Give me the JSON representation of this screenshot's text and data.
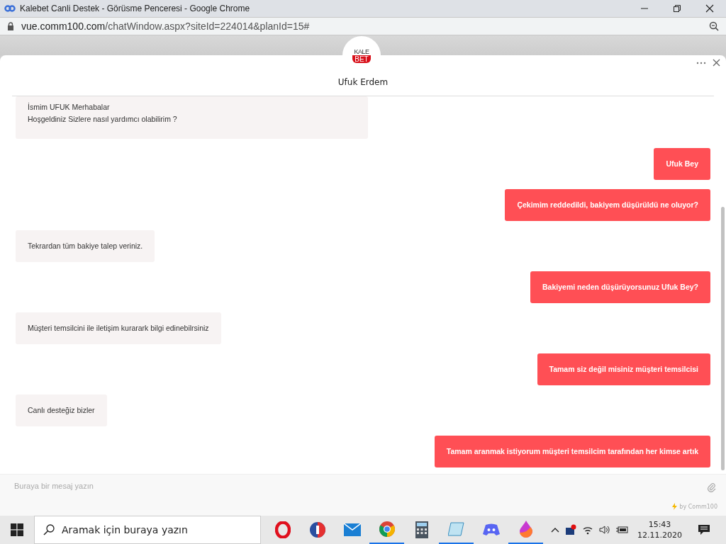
{
  "window": {
    "title": "Kalebet Canli Destek - Görüsme Penceresi - Google Chrome"
  },
  "address_bar": {
    "host": "vue.comm100.com",
    "path": "/chatWindow.aspx?siteId=224014&planId=15#"
  },
  "chat": {
    "logo_top": "KALE",
    "logo_bottom": "BET",
    "agent_name": "Ufuk Erdem",
    "messages": [
      {
        "kind": "agent",
        "lines": [
          "İsmim UFUK Merhabalar",
          "Hoşgeldiniz Sizlere nasıl yardımcı olabilirim ?"
        ]
      },
      {
        "kind": "visitor",
        "lines": [
          "Ufuk Bey"
        ]
      },
      {
        "kind": "visitor",
        "lines": [
          "Çekimim reddedildi, bakiyem düşürüldü ne oluyor?"
        ]
      },
      {
        "kind": "agent",
        "lines": [
          "Tekrardan tüm bakiye talep veriniz."
        ]
      },
      {
        "kind": "visitor",
        "lines": [
          "Bakiyemi neden düşürüyorsunuz Ufuk Bey?"
        ]
      },
      {
        "kind": "agent",
        "lines": [
          "Müşteri temsilcini ile iletişim kurarark bilgi edinebilrsiniz"
        ]
      },
      {
        "kind": "visitor",
        "lines": [
          "Tamam siz değil misiniz müşteri temsilcisi"
        ]
      },
      {
        "kind": "agent",
        "lines": [
          "Canlı desteğiz bizler"
        ]
      },
      {
        "kind": "visitor",
        "lines": [
          "Tamam aranmak istiyorum müşteri temsilcim tarafından her kimse artık"
        ]
      }
    ],
    "input": {
      "placeholder": "Buraya bir mesaj yazın"
    },
    "powered_by": "by Comm100"
  },
  "taskbar": {
    "search_placeholder": "Aramak için buraya yazın",
    "time": "15:43",
    "date": "12.11.2020"
  }
}
